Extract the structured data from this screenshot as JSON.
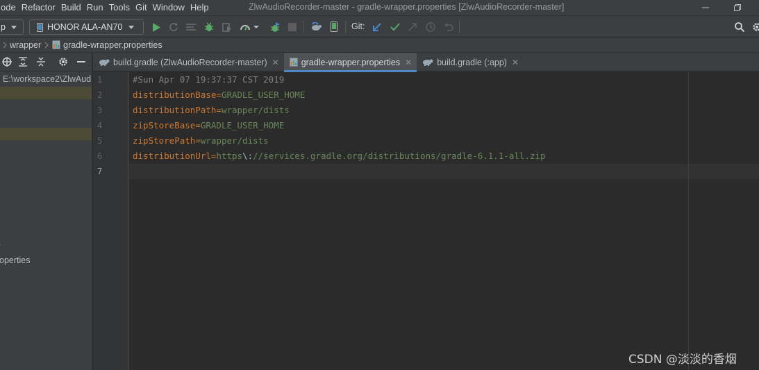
{
  "menu": [
    "ode",
    "Refactor",
    "Build",
    "Run",
    "Tools",
    "Git",
    "Window",
    "Help"
  ],
  "window_title": "ZlwAudioRecorder-master - gradle-wrapper.properties [ZlwAudioRecorder-master]",
  "toolbar": {
    "config_label": "p",
    "device_label": "HONOR ALA-AN70",
    "git_label": "Git:"
  },
  "breadcrumb": {
    "folder": "wrapper",
    "file": "gradle-wrapper.properties"
  },
  "project": {
    "path": "E:\\workspace2\\ZlwAud",
    "properties_fragment": "operties",
    "dot_fragment": "."
  },
  "tabs": [
    {
      "label": "build.gradle (ZlwAudioRecorder-master)",
      "icon": "gradle-icon",
      "active": false
    },
    {
      "label": "gradle-wrapper.properties",
      "icon": "properties-icon",
      "active": true
    },
    {
      "label": "build.gradle (:app)",
      "icon": "gradle-icon",
      "active": false
    }
  ],
  "editor": {
    "line_numbers": [
      "1",
      "2",
      "3",
      "4",
      "5",
      "6",
      "7"
    ],
    "comment": "#Sun Apr 07 19:37:37 CST 2019",
    "lines": [
      {
        "key": "distributionBase",
        "value": "GRADLE_USER_HOME"
      },
      {
        "key": "distributionPath",
        "value": "wrapper/dists"
      },
      {
        "key": "zipStoreBase",
        "value": "GRADLE_USER_HOME"
      },
      {
        "key": "zipStorePath",
        "value": "wrapper/dists"
      }
    ],
    "url_line": {
      "key": "distributionUrl",
      "scheme": "https",
      "escape": "\\:",
      "rest": "//services.gradle.org/distributions/gradle-6.1.1-all.zip"
    },
    "eq": "="
  },
  "colors": {
    "accent": "#4a88c7",
    "run_green": "#59a869",
    "key_orange": "#cc7832",
    "value_green": "#6a8759",
    "comment_gray": "#808080"
  },
  "watermark": "CSDN @淡淡的香烟"
}
